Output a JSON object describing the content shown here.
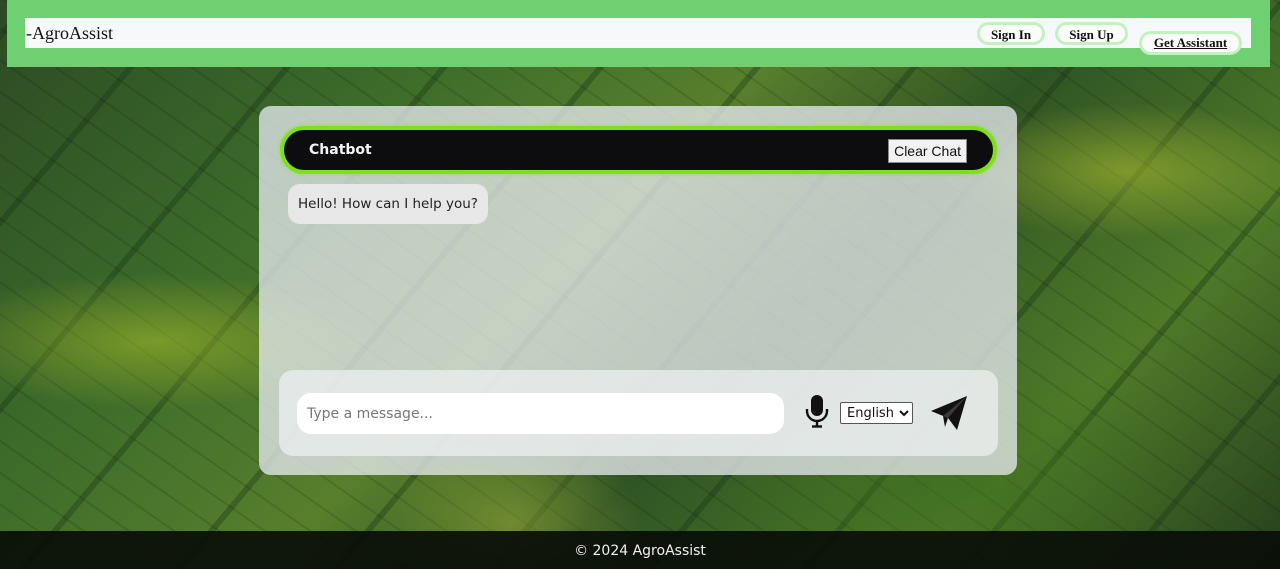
{
  "header": {
    "brand": "-AgroAssist",
    "nav": {
      "sign_in": "Sign In",
      "sign_up": "Sign Up",
      "get_assistant": "Get Assistant"
    }
  },
  "chat": {
    "title": "Chatbot",
    "clear_label": "Clear Chat",
    "messages": [
      {
        "sender": "bot",
        "text": "Hello! How can I help you?"
      }
    ],
    "input_placeholder": "Type a message...",
    "language_selected": "English",
    "mic_icon": "microphone-icon",
    "send_icon": "paper-plane-icon"
  },
  "footer": {
    "text": "© 2024 AgroAssist"
  },
  "colors": {
    "header_green": "#6fd071",
    "chat_header_border": "#7fe01a",
    "chat_header_bg": "#0d0d10"
  }
}
